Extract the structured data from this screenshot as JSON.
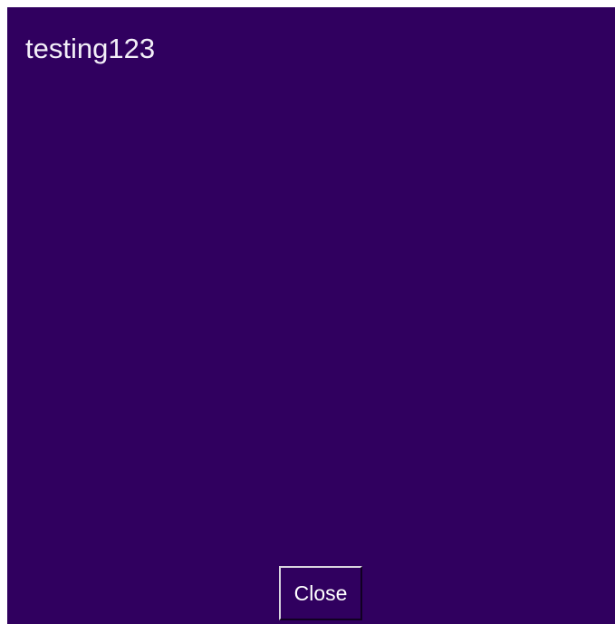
{
  "dialog": {
    "message": "testing123",
    "close_label": "Close",
    "background_color": "#30005f",
    "text_color": "#f3eff8"
  }
}
